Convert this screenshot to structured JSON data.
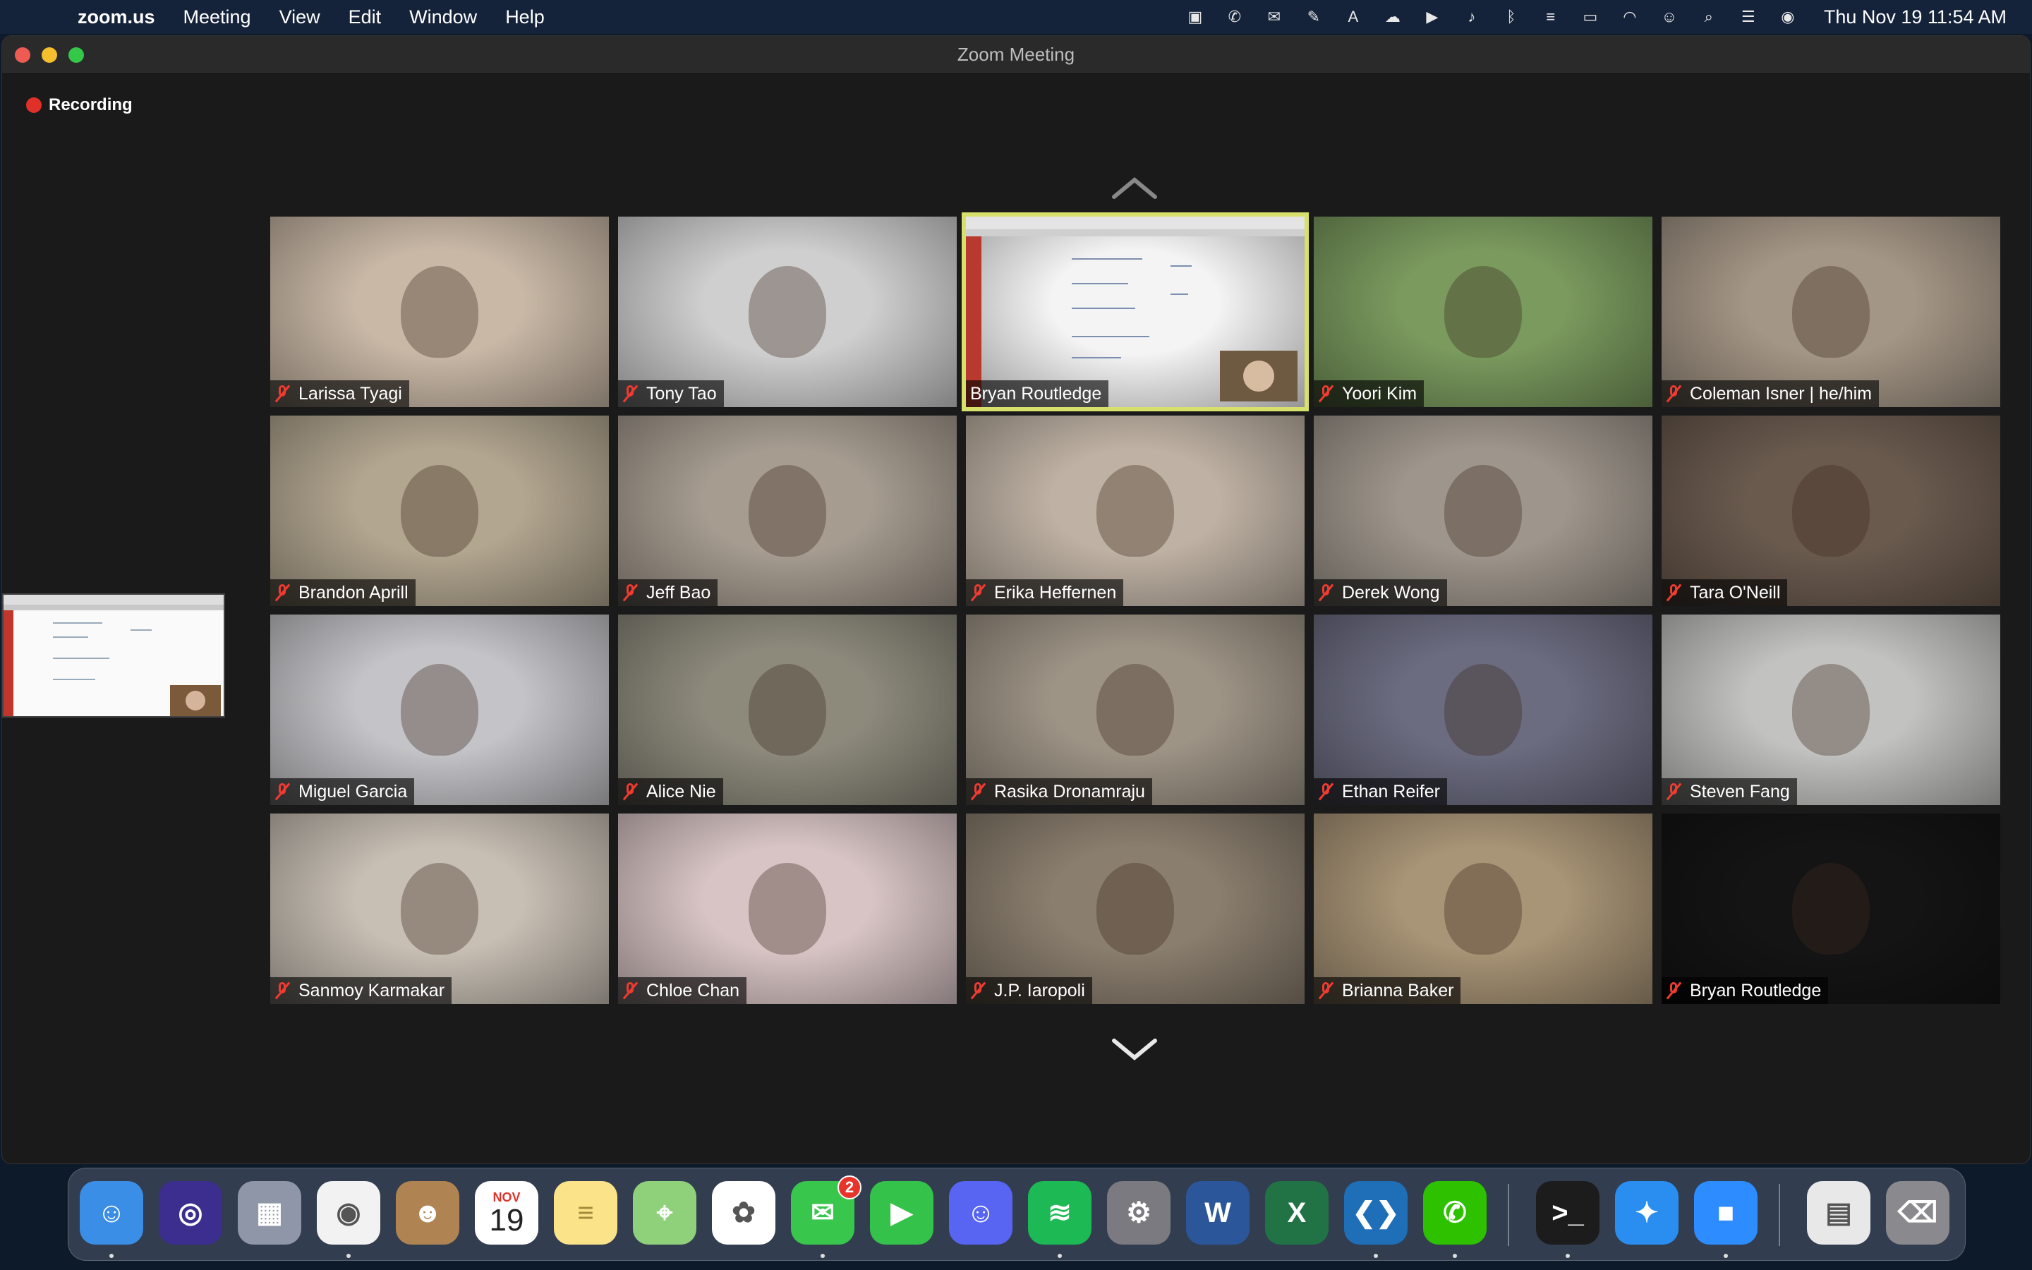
{
  "menubar": {
    "app_name": "zoom.us",
    "menus": [
      "Meeting",
      "View",
      "Edit",
      "Window",
      "Help"
    ],
    "clock": "Thu Nov 19  11:54 AM",
    "status_icons": [
      "screen-record-icon",
      "wechat-icon",
      "notification-icon",
      "script-icon",
      "adobe-icon",
      "creative-cloud-icon",
      "play-icon",
      "volume-icon",
      "bluetooth-icon",
      "us-flag-icon",
      "battery-icon",
      "wifi-icon",
      "user-icon",
      "search-icon",
      "control-center-icon",
      "siri-icon"
    ]
  },
  "window": {
    "title": "Zoom Meeting",
    "recording_label": "Recording"
  },
  "participants": [
    {
      "name": "Larissa Tyagi",
      "muted": true,
      "bg": "#c9b8a6"
    },
    {
      "name": "Tony Tao",
      "muted": true,
      "bg": "#cfcfcf"
    },
    {
      "name": "Bryan Routledge",
      "muted": false,
      "bg": "#f4f4f4",
      "active_speaker": true
    },
    {
      "name": "Yoori Kim",
      "muted": true,
      "bg": "#7a9a5e"
    },
    {
      "name": "Coleman Isner | he/him",
      "muted": true,
      "bg": "#a49686"
    },
    {
      "name": "Brandon Aprill",
      "muted": true,
      "bg": "#b2a690"
    },
    {
      "name": "Jeff Bao",
      "muted": true,
      "bg": "#a69c90"
    },
    {
      "name": "Erika Heffernen",
      "muted": true,
      "bg": "#bfb2a4"
    },
    {
      "name": "Derek Wong",
      "muted": true,
      "bg": "#9e968c"
    },
    {
      "name": "Tara O'Neill",
      "muted": true,
      "bg": "#6a5a4e"
    },
    {
      "name": "Miguel Garcia",
      "muted": true,
      "bg": "#c4c4c8"
    },
    {
      "name": "Alice Nie",
      "muted": true,
      "bg": "#8d8a7c"
    },
    {
      "name": "Rasika Dronamraju",
      "muted": true,
      "bg": "#9e9486"
    },
    {
      "name": "Ethan Reifer",
      "muted": true,
      "bg": "#6b6c80"
    },
    {
      "name": "Steven Fang",
      "muted": true,
      "bg": "#c2c2c0"
    },
    {
      "name": "Sanmoy Karmakar",
      "muted": true,
      "bg": "#c7bfb4"
    },
    {
      "name": "Chloe Chan",
      "muted": true,
      "bg": "#d8c4c4"
    },
    {
      "name": "J.P. Iaropoli",
      "muted": true,
      "bg": "#8a7e6e"
    },
    {
      "name": "Brianna Baker",
      "muted": true,
      "bg": "#a89476"
    },
    {
      "name": "Bryan Routledge",
      "muted": true,
      "bg": "#141414"
    }
  ],
  "dock": {
    "apps": [
      {
        "name": "finder-icon",
        "color": "#3a8ee6",
        "glyph": "☺"
      },
      {
        "name": "siri-icon",
        "color": "#3c2e8e",
        "glyph": "◎"
      },
      {
        "name": "launchpad-icon",
        "color": "#8e96a8",
        "glyph": "▦"
      },
      {
        "name": "chrome-icon",
        "color": "#f2f2f2",
        "glyph": "◉"
      },
      {
        "name": "contacts-icon",
        "color": "#b08452",
        "glyph": "☻"
      },
      {
        "name": "calendar-icon",
        "color": "#ffffff",
        "glyph": "19"
      },
      {
        "name": "notes-icon",
        "color": "#fbe38a",
        "glyph": "≡"
      },
      {
        "name": "maps-icon",
        "color": "#8fd07a",
        "glyph": "⌖"
      },
      {
        "name": "photos-icon",
        "color": "#ffffff",
        "glyph": "✿"
      },
      {
        "name": "messages-icon",
        "color": "#38c64c",
        "glyph": "✉"
      },
      {
        "name": "facetime-icon",
        "color": "#34c24a",
        "glyph": "▶"
      },
      {
        "name": "discord-icon",
        "color": "#5865f2",
        "glyph": "☺"
      },
      {
        "name": "spotify-icon",
        "color": "#1db954",
        "glyph": "≋"
      },
      {
        "name": "system-preferences-icon",
        "color": "#7a7a80",
        "glyph": "⚙"
      },
      {
        "name": "word-icon",
        "color": "#2b579a",
        "glyph": "W"
      },
      {
        "name": "excel-icon",
        "color": "#217346",
        "glyph": "X"
      },
      {
        "name": "vscode-icon",
        "color": "#1e6fb8",
        "glyph": "❮❯"
      },
      {
        "name": "wechat-icon",
        "color": "#2dc100",
        "glyph": "✆"
      },
      {
        "name": "terminal-icon",
        "color": "#1c1c1c",
        "glyph": ">_"
      },
      {
        "name": "safari-icon",
        "color": "#2a8ef0",
        "glyph": "✦"
      },
      {
        "name": "zoom-icon",
        "color": "#2d8cff",
        "glyph": "■"
      },
      {
        "name": "archive-icon",
        "color": "#e8e8e8",
        "glyph": "▤"
      },
      {
        "name": "trash-icon",
        "color": "#8a8a8e",
        "glyph": "⌫"
      }
    ],
    "calendar_month": "NOV",
    "calendar_day": "19",
    "messages_badge": "2"
  }
}
